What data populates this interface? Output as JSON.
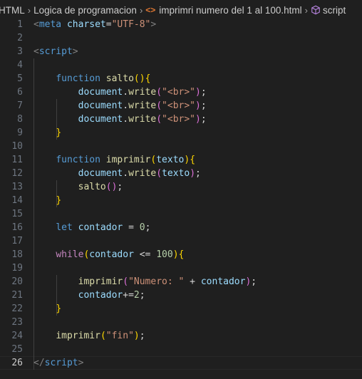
{
  "breadcrumb": {
    "root": "HTML",
    "folder": "Logica de programacion",
    "file": "imprimri numero del 1 al 100.html",
    "symbol": "script",
    "icons": {
      "file": "html-file-icon",
      "symbol": "cube-icon"
    }
  },
  "editor": {
    "active_line": "26",
    "line_numbers": [
      "1",
      "2",
      "3",
      "4",
      "5",
      "6",
      "7",
      "8",
      "9",
      "10",
      "11",
      "12",
      "13",
      "14",
      "15",
      "16",
      "17",
      "18",
      "19",
      "20",
      "21",
      "22",
      "23",
      "24",
      "25",
      "26"
    ],
    "lines": [
      [
        [
          "tag",
          "<"
        ],
        [
          "tagname",
          "meta"
        ],
        [
          "op",
          " "
        ],
        [
          "attr",
          "charset"
        ],
        [
          "op",
          "="
        ],
        [
          "str",
          "\"UTF-8\""
        ],
        [
          "tag",
          ">"
        ]
      ],
      [],
      [
        [
          "tag",
          "<"
        ],
        [
          "tagname",
          "script"
        ],
        [
          "tag",
          ">"
        ]
      ],
      [],
      [
        [
          "op",
          "    "
        ],
        [
          "kw",
          "function"
        ],
        [
          "op",
          " "
        ],
        [
          "fn",
          "salto"
        ],
        [
          "p1",
          "()"
        ],
        [
          "p1",
          "{"
        ]
      ],
      [
        [
          "op",
          "        "
        ],
        [
          "var",
          "document"
        ],
        [
          "op",
          "."
        ],
        [
          "fn",
          "write"
        ],
        [
          "p2",
          "("
        ],
        [
          "str",
          "\"<br>\""
        ],
        [
          "p2",
          ")"
        ],
        [
          "op",
          ";"
        ]
      ],
      [
        [
          "op",
          "        "
        ],
        [
          "var",
          "document"
        ],
        [
          "op",
          "."
        ],
        [
          "fn",
          "write"
        ],
        [
          "p2",
          "("
        ],
        [
          "str",
          "\"<br>\""
        ],
        [
          "p2",
          ")"
        ],
        [
          "op",
          ";"
        ]
      ],
      [
        [
          "op",
          "        "
        ],
        [
          "var",
          "document"
        ],
        [
          "op",
          "."
        ],
        [
          "fn",
          "write"
        ],
        [
          "p2",
          "("
        ],
        [
          "str",
          "\"<br>\""
        ],
        [
          "p2",
          ")"
        ],
        [
          "op",
          ";"
        ]
      ],
      [
        [
          "op",
          "    "
        ],
        [
          "p1",
          "}"
        ]
      ],
      [],
      [
        [
          "op",
          "    "
        ],
        [
          "kw",
          "function"
        ],
        [
          "op",
          " "
        ],
        [
          "fn",
          "imprimir"
        ],
        [
          "p1",
          "("
        ],
        [
          "var",
          "texto"
        ],
        [
          "p1",
          ")"
        ],
        [
          "p1",
          "{"
        ]
      ],
      [
        [
          "op",
          "        "
        ],
        [
          "var",
          "document"
        ],
        [
          "op",
          "."
        ],
        [
          "fn",
          "write"
        ],
        [
          "p2",
          "("
        ],
        [
          "var",
          "texto"
        ],
        [
          "p2",
          ")"
        ],
        [
          "op",
          ";"
        ]
      ],
      [
        [
          "op",
          "        "
        ],
        [
          "fn",
          "salto"
        ],
        [
          "p2",
          "()"
        ],
        [
          "op",
          ";"
        ]
      ],
      [
        [
          "op",
          "    "
        ],
        [
          "p1",
          "}"
        ]
      ],
      [],
      [
        [
          "op",
          "    "
        ],
        [
          "kw",
          "let"
        ],
        [
          "op",
          " "
        ],
        [
          "var",
          "contador"
        ],
        [
          "op",
          " = "
        ],
        [
          "num",
          "0"
        ],
        [
          "op",
          ";"
        ]
      ],
      [],
      [
        [
          "op",
          "    "
        ],
        [
          "ctrl",
          "while"
        ],
        [
          "p1",
          "("
        ],
        [
          "var",
          "contador"
        ],
        [
          "op",
          " <= "
        ],
        [
          "num",
          "100"
        ],
        [
          "p1",
          ")"
        ],
        [
          "p1",
          "{"
        ]
      ],
      [],
      [
        [
          "op",
          "        "
        ],
        [
          "fn",
          "imprimir"
        ],
        [
          "p2",
          "("
        ],
        [
          "str",
          "\"Numero: \""
        ],
        [
          "op",
          " + "
        ],
        [
          "var",
          "contador"
        ],
        [
          "p2",
          ")"
        ],
        [
          "op",
          ";"
        ]
      ],
      [
        [
          "op",
          "        "
        ],
        [
          "var",
          "contador"
        ],
        [
          "op",
          "+="
        ],
        [
          "num",
          "2"
        ],
        [
          "op",
          ";"
        ]
      ],
      [
        [
          "op",
          "    "
        ],
        [
          "p1",
          "}"
        ]
      ],
      [],
      [
        [
          "op",
          "    "
        ],
        [
          "fn",
          "imprimir"
        ],
        [
          "p1",
          "("
        ],
        [
          "str",
          "\"fin\""
        ],
        [
          "p1",
          ")"
        ],
        [
          "op",
          ";"
        ]
      ],
      [],
      [
        [
          "tag",
          "</"
        ],
        [
          "tagname",
          "script"
        ],
        [
          "tag",
          ">"
        ]
      ]
    ]
  }
}
